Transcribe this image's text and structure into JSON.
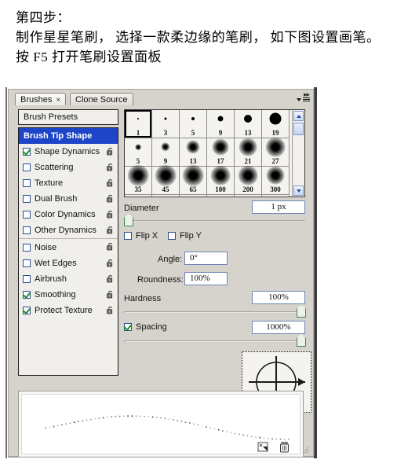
{
  "intro": {
    "lines": [
      "第四步：",
      "制作星星笔刷， 选择一款柔边缘的笔刷， 如下图设置画笔。",
      "按 F5 打开笔刷设置面板"
    ]
  },
  "panel": {
    "tabs": [
      {
        "label": "Brushes",
        "close": "×",
        "active": true
      },
      {
        "label": "Clone Source",
        "close": "",
        "active": false
      }
    ],
    "collapse_icon": "▶▶",
    "menu_icon": "panel-menu-icon",
    "presets_label": "Brush Presets",
    "options": [
      {
        "label": "Brush Tip Shape",
        "selected": true,
        "checkbox": false,
        "checked": false,
        "lock": false,
        "divider": false
      },
      {
        "label": "Shape Dynamics",
        "selected": false,
        "checkbox": true,
        "checked": true,
        "lock": true,
        "divider": false
      },
      {
        "label": "Scattering",
        "selected": false,
        "checkbox": true,
        "checked": false,
        "lock": true,
        "divider": false
      },
      {
        "label": "Texture",
        "selected": false,
        "checkbox": true,
        "checked": false,
        "lock": true,
        "divider": false
      },
      {
        "label": "Dual Brush",
        "selected": false,
        "checkbox": true,
        "checked": false,
        "lock": true,
        "divider": false
      },
      {
        "label": "Color Dynamics",
        "selected": false,
        "checkbox": true,
        "checked": false,
        "lock": true,
        "divider": false
      },
      {
        "label": "Other Dynamics",
        "selected": false,
        "checkbox": true,
        "checked": false,
        "lock": true,
        "divider": false
      },
      {
        "label": "Noise",
        "selected": false,
        "checkbox": true,
        "checked": false,
        "lock": true,
        "divider": true
      },
      {
        "label": "Wet Edges",
        "selected": false,
        "checkbox": true,
        "checked": false,
        "lock": true,
        "divider": false
      },
      {
        "label": "Airbrush",
        "selected": false,
        "checkbox": true,
        "checked": false,
        "lock": true,
        "divider": false
      },
      {
        "label": "Smoothing",
        "selected": false,
        "checkbox": true,
        "checked": true,
        "lock": true,
        "divider": false
      },
      {
        "label": "Protect Texture",
        "selected": false,
        "checkbox": true,
        "checked": true,
        "lock": true,
        "divider": false
      }
    ],
    "brush_grid": {
      "selected_index": 0,
      "rows": [
        {
          "style": "hard",
          "items": [
            {
              "size": "1",
              "dot": 2
            },
            {
              "size": "3",
              "dot": 3
            },
            {
              "size": "5",
              "dot": 4
            },
            {
              "size": "9",
              "dot": 7
            },
            {
              "size": "13",
              "dot": 10
            },
            {
              "size": "19",
              "dot": 15
            }
          ]
        },
        {
          "style": "soft",
          "items": [
            {
              "size": "5",
              "dot": 4
            },
            {
              "size": "9",
              "dot": 6
            },
            {
              "size": "13",
              "dot": 9
            },
            {
              "size": "17",
              "dot": 11
            },
            {
              "size": "21",
              "dot": 12
            },
            {
              "size": "27",
              "dot": 13
            }
          ]
        },
        {
          "style": "soft",
          "items": [
            {
              "size": "35",
              "dot": 14
            },
            {
              "size": "45",
              "dot": 14
            },
            {
              "size": "65",
              "dot": 14
            },
            {
              "size": "100",
              "dot": 13
            },
            {
              "size": "200",
              "dot": 13
            },
            {
              "size": "300",
              "dot": 12
            }
          ]
        },
        {
          "style": "scatter",
          "items": [
            {
              "size": "",
              "dot": 0
            },
            {
              "size": "",
              "dot": 0
            },
            {
              "size": "",
              "dot": 0
            },
            {
              "size": "",
              "dot": 0
            },
            {
              "size": "",
              "dot": 0
            },
            {
              "size": "",
              "dot": 0
            }
          ]
        }
      ]
    },
    "controls": {
      "diameter": {
        "label": "Diameter",
        "value": "1 px",
        "slider_pct": 0
      },
      "flip_x": {
        "label": "Flip X",
        "checked": false
      },
      "flip_y": {
        "label": "Flip Y",
        "checked": false
      },
      "angle": {
        "label": "Angle:",
        "value": "0°"
      },
      "roundness": {
        "label": "Roundness:",
        "value": "100%"
      },
      "hardness": {
        "label": "Hardness",
        "value": "100%",
        "slider_pct": 100
      },
      "spacing": {
        "label": "Spacing",
        "value": "1000%",
        "slider_pct": 100,
        "checked": true
      }
    },
    "footer": {
      "new_brush_icon": "new-brush-icon",
      "delete_brush_icon": "trash-icon",
      "resize_grip": "resize-grip"
    }
  },
  "colors": {
    "selection_blue": "#1d45c8",
    "panel_bg": "#d6d3cc",
    "field_border": "#6e86b5",
    "check_green": "#1b8a2a",
    "knob_green": "#3f8a3f"
  }
}
